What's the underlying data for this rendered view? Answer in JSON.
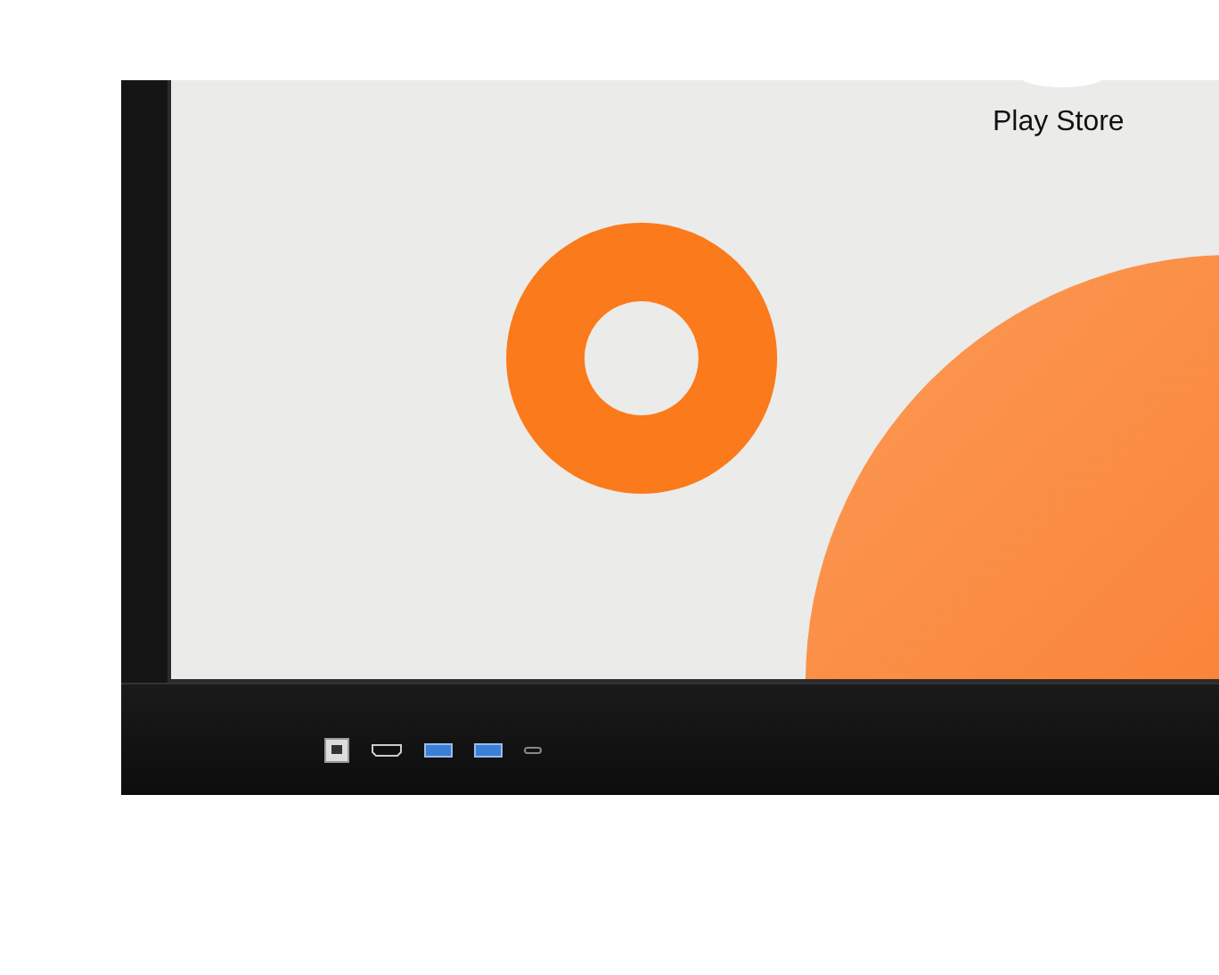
{
  "screen": {
    "app_label": "Play Store"
  }
}
